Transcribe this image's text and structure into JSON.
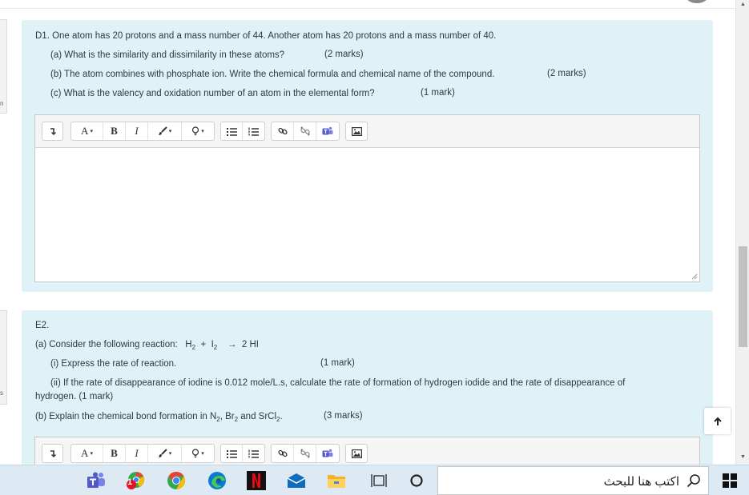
{
  "questions": {
    "d1": {
      "stem": "D1. One atom has 20 protons and a mass number of 44. Another atom has 20 protons and a mass number of 40.",
      "parts": [
        {
          "text": "(a)  What is the similarity and dissimilarity in these atoms?",
          "marks": "(2 marks)"
        },
        {
          "text": "(b)  The atom combines with phosphate ion. Write the chemical formula and chemical name of the compound.",
          "marks": "(2 marks)"
        },
        {
          "text": "(c)  What is the valency and oxidation number of an atom in the elemental form?",
          "marks": "(1 mark)"
        }
      ]
    },
    "e2": {
      "title": "E2.",
      "a_prefix": "(a) Consider the following reaction:",
      "a_eq_h": "H",
      "a_eq_h_sub": "2",
      "a_eq_plus": "+",
      "a_eq_i": "I",
      "a_eq_i_sub": "2",
      "a_eq_arrow": "→",
      "a_eq_product": "2 HI",
      "ai_text": "(i)  Express the rate of reaction.",
      "ai_marks": "(1 mark)",
      "aii_text": "(ii)  If the rate of disappearance of iodine is 0.012 mole/L.s, calculate the rate of formation of hydrogen iodide and the rate of disappearance of",
      "aii_cont": "hydrogen. (1 mark)",
      "b_prefix": "(b) Explain the chemical bond formation in N",
      "b_n_sub": "2",
      "b_mid1": ", Br",
      "b_br_sub": "2",
      "b_mid2": " and SrCl",
      "b_sr_sub": "2",
      "b_end": ".",
      "b_marks": "(3 marks)"
    }
  },
  "toolbar": {
    "font_label": "A",
    "bold_label": "B",
    "italic_label": "I",
    "caret": "▾"
  },
  "taskbar": {
    "search_placeholder": "اكتب هنا للبحث",
    "badge_count": "1"
  },
  "colors": {
    "question_bg": "#def2f8",
    "taskbar_bg": "#dde9f3",
    "netflix": "#e50914",
    "teams": "#5059c9"
  }
}
